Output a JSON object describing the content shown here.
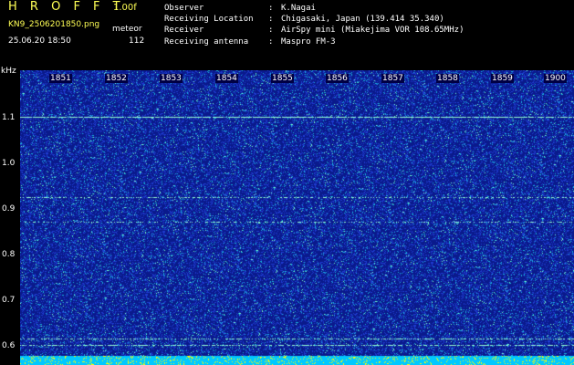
{
  "header": {
    "app_title": "HROFFT",
    "version": "1.00f",
    "filename": "KN9_2506201850.png",
    "mode": "meteor",
    "datetime": "25.06.20 18:50",
    "count": "112",
    "info": [
      {
        "key": "Observer",
        "sep": ":",
        "value": "K.Nagai"
      },
      {
        "key": "Receiving Location",
        "sep": ":",
        "value": "Chigasaki, Japan (139.414 35.340)"
      },
      {
        "key": "Receiver",
        "sep": ":",
        "value": "AirSpy mini (Miakejima VOR 108.65MHz)"
      },
      {
        "key": "Receiving antenna",
        "sep": ":",
        "value": "Maspro FM-3"
      }
    ]
  },
  "plot": {
    "y_unit": "kHz",
    "y_ticks": [
      "1.1",
      "1.0",
      "0.9",
      "0.8",
      "0.7",
      "0.6"
    ],
    "x_ticks": [
      "1851",
      "1852",
      "1853",
      "1854",
      "1855",
      "1856",
      "1857",
      "1858",
      "1859",
      "1900"
    ]
  },
  "colors": {
    "background": "#000000",
    "header_text": "#ffffff",
    "title_accent": "#ffff55",
    "plot_base": "#0a1a8c",
    "noise_low": "#1e3cd0",
    "noise_mid": "#19b4dc",
    "noise_high": "#78ffc8",
    "carrier": "#96ffd2",
    "bottom_strip": "#00c8ff",
    "bottom_strip_accent": "#ffff00"
  }
}
